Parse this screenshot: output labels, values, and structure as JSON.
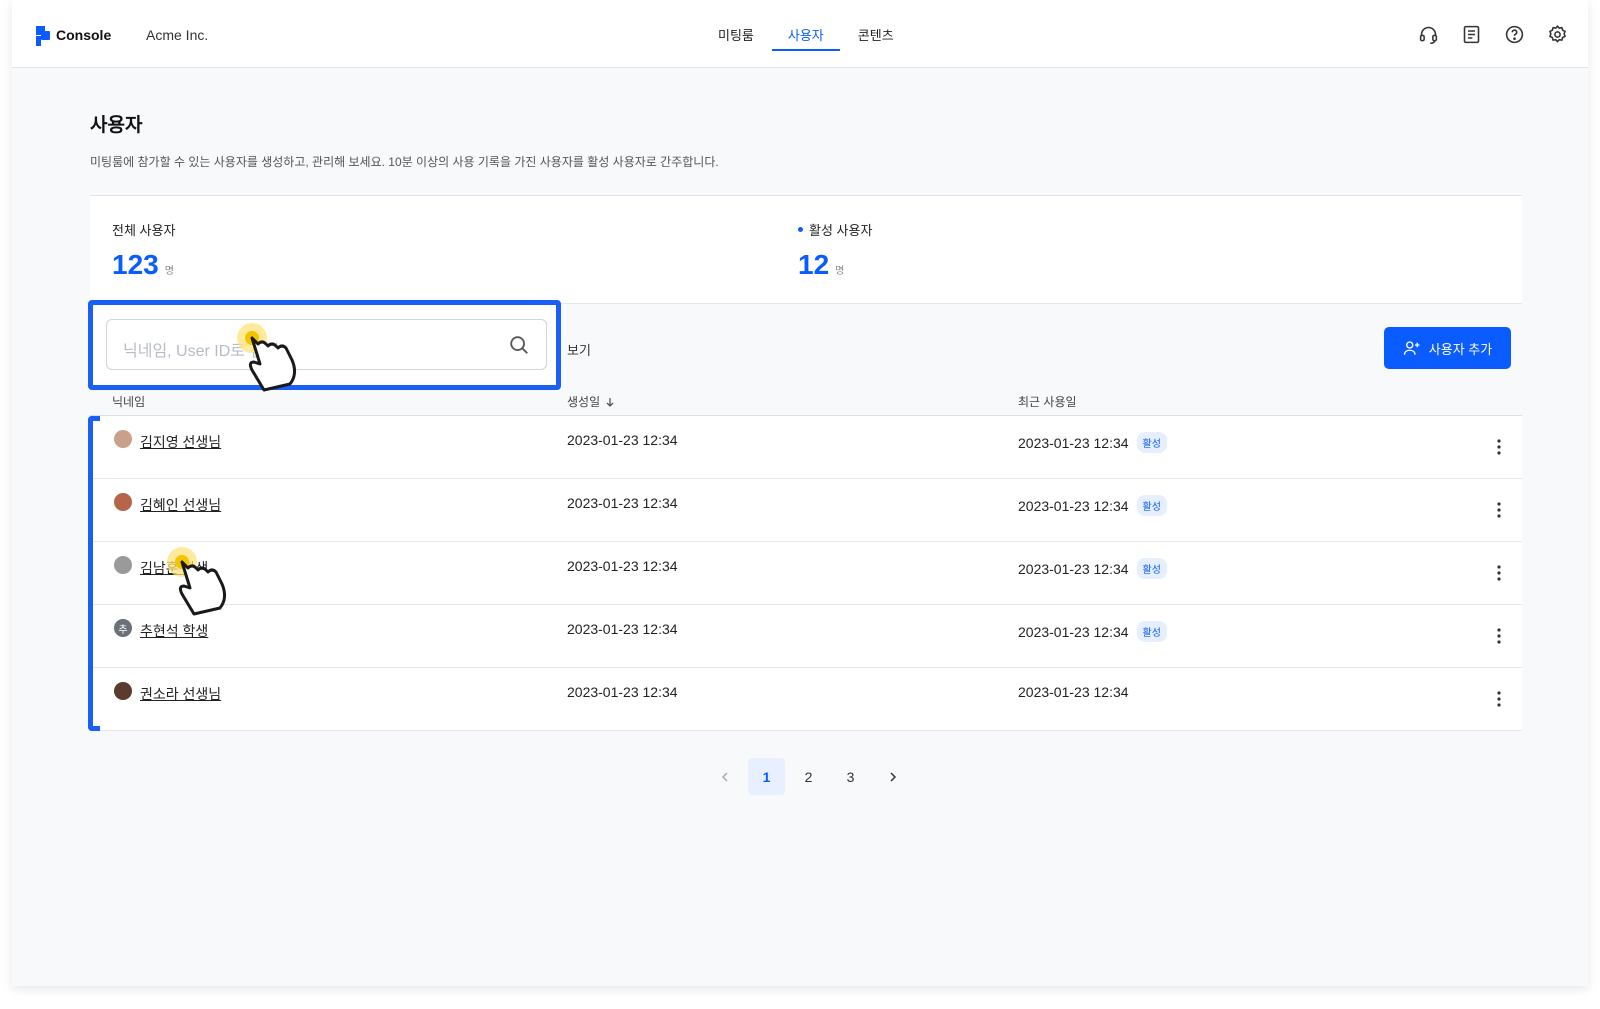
{
  "header": {
    "brand": "Console",
    "org": "Acme Inc.",
    "nav": [
      {
        "label": "미팅룸",
        "active": false
      },
      {
        "label": "사용자",
        "active": true
      },
      {
        "label": "콘텐츠",
        "active": false
      }
    ],
    "icons": [
      "headset-icon",
      "document-icon",
      "help-icon",
      "settings-icon"
    ]
  },
  "page": {
    "title": "사용자",
    "description": "미팅룸에 참가할 수 있는 사용자를 생성하고, 관리해 보세요. 10분 이상의 사용 기록을 가진 사용자를 활성 사용자로 간주합니다."
  },
  "stats": {
    "total_label": "전체 사용자",
    "total_value": "123",
    "total_unit": "명",
    "active_label": "활성 사용자",
    "active_value": "12",
    "active_unit": "명"
  },
  "toolbar": {
    "search_placeholder": "닉네임, User ID로 검색",
    "view_label": "보기",
    "add_button": "사용자 추가"
  },
  "table": {
    "columns": [
      "닉네임",
      "생성일",
      "최근 사용일"
    ],
    "rows": [
      {
        "name": "김지영 선생님",
        "created": "2023-01-23 12:34",
        "recent": "2023-01-23 12:34",
        "badge": "활성",
        "avatar_color": "#c9a08a",
        "avatar_text": ""
      },
      {
        "name": "김혜인 선생님",
        "created": "2023-01-23 12:34",
        "recent": "2023-01-23 12:34",
        "badge": "활성",
        "avatar_color": "#b5654a",
        "avatar_text": ""
      },
      {
        "name": "김남훈 학생",
        "created": "2023-01-23 12:34",
        "recent": "2023-01-23 12:34",
        "badge": "활성",
        "avatar_color": "#9a9a9a",
        "avatar_text": ""
      },
      {
        "name": "추현석 학생",
        "created": "2023-01-23 12:34",
        "recent": "2023-01-23 12:34",
        "badge": "활성",
        "avatar_color": "#6b6f78",
        "avatar_text": "추"
      },
      {
        "name": "권소라 선생님",
        "created": "2023-01-23 12:34",
        "recent": "2023-01-23 12:34",
        "badge": "",
        "avatar_color": "#5a3b2c",
        "avatar_text": ""
      }
    ]
  },
  "pagination": {
    "pages": [
      "1",
      "2",
      "3"
    ],
    "current": "1"
  },
  "colors": {
    "accent": "#0a5cff",
    "highlight": "#1b5ff5",
    "badge_bg": "#e6efff"
  }
}
